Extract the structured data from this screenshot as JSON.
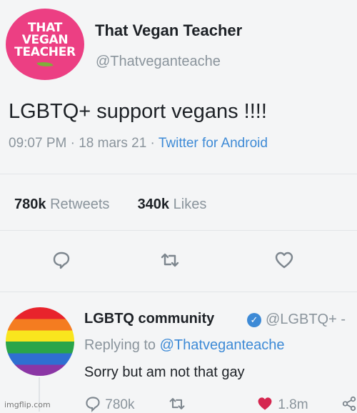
{
  "tweet": {
    "avatar_logo_lines": [
      "THAT",
      "VEGAN",
      "TEACHER"
    ],
    "display_name": "That Vegan Teacher",
    "handle": "@Thatveganteache",
    "text": "LGBTQ+ support vegans !!!!",
    "time": "09:07 PM",
    "date": "18 mars 21",
    "client": "Twitter for Android",
    "retweets_count": "780k",
    "retweets_label": "Retweets",
    "likes_count": "340k",
    "likes_label": "Likes"
  },
  "actions": [
    "reply-icon",
    "retweet-icon",
    "like-icon"
  ],
  "reply": {
    "display_name": "LGBTQ community",
    "handle": "@LGBTQ+ -",
    "replying_prefix": "Replying to",
    "replying_handle": "@Thatveganteache",
    "text": "Sorry but am not that gay",
    "reply_count": "780k",
    "like_count": "1.8m"
  },
  "watermark": "imgflip.com",
  "colors": {
    "brand_pink": "#ec3f83",
    "link_blue": "#3d8ad6",
    "like_red": "#d5264f",
    "muted": "#8a949c"
  }
}
